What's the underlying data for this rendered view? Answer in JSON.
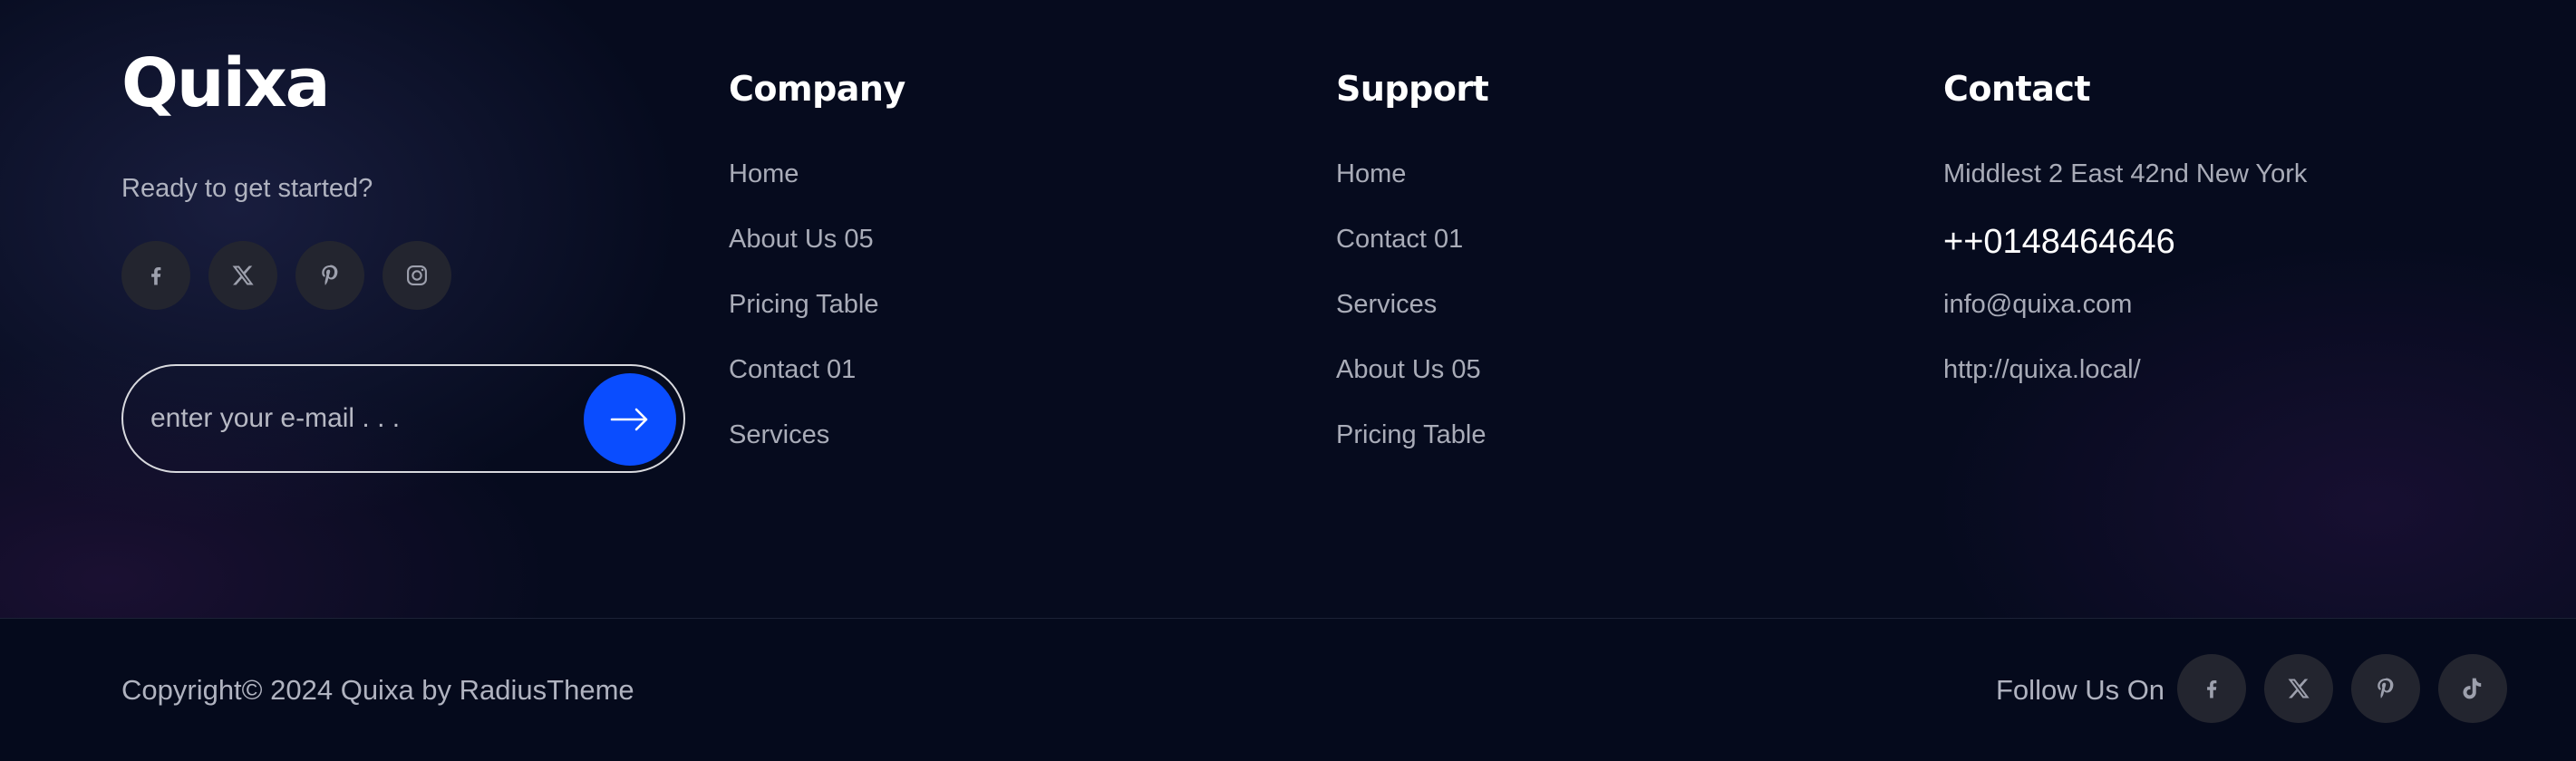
{
  "brand": {
    "logo": "Quixa",
    "tagline": "Ready to get started?",
    "social": [
      "facebook-icon",
      "x-twitter-icon",
      "pinterest-icon",
      "instagram-icon"
    ]
  },
  "subscribe": {
    "placeholder": "enter your e-mail . . .",
    "button_icon": "arrow-right-icon",
    "button_color": "#0a4dff"
  },
  "company": {
    "title": "Company",
    "links": [
      "Home",
      "About Us 05",
      "Pricing Table",
      "Contact 01",
      "Services"
    ]
  },
  "support": {
    "title": "Support",
    "links": [
      "Home",
      "Contact 01",
      "Services",
      "About Us 05",
      "Pricing Table"
    ]
  },
  "contact": {
    "title": "Contact",
    "address": "Middlest 2 East 42nd New York",
    "phone": "++0148464646",
    "email": "info@quixa.com",
    "website": "http://quixa.local/"
  },
  "bottom": {
    "copyright": "Copyright© 2024 Quixa by RadiusTheme",
    "follow_label": "Follow Us On",
    "social": [
      "facebook-icon",
      "x-twitter-icon",
      "pinterest-icon",
      "tiktok-icon"
    ]
  },
  "colors": {
    "background": "#060b1e",
    "accent": "#0a4dff",
    "icon_bg": "#23252f"
  }
}
